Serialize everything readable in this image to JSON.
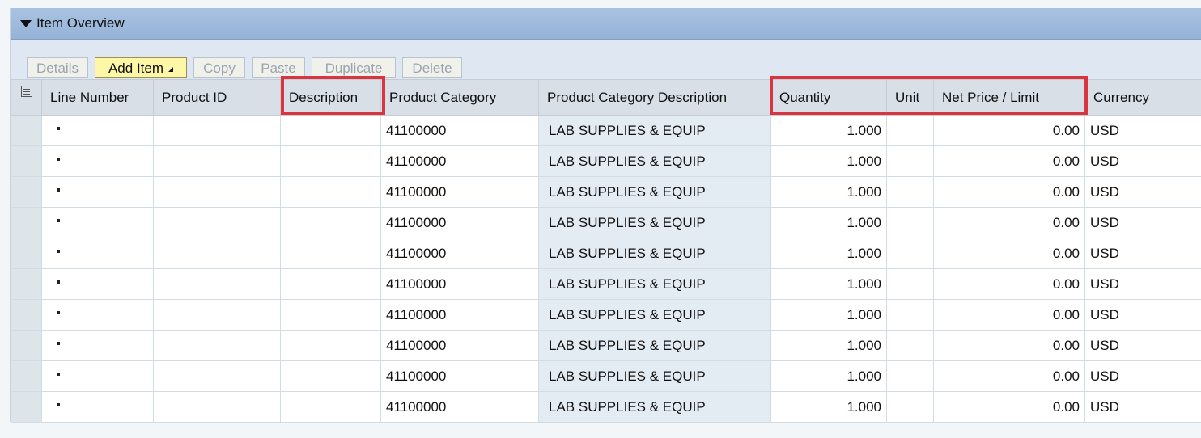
{
  "panel": {
    "title": "Item Overview"
  },
  "toolbar": {
    "details_label": "Details",
    "add_item_label": "Add Item",
    "copy_label": "Copy",
    "paste_label": "Paste",
    "duplicate_label": "Duplicate",
    "delete_label": "Delete"
  },
  "table": {
    "columns": {
      "line_number": "Line Number",
      "product_id": "Product ID",
      "description": "Description",
      "product_category": "Product Category",
      "product_category_description": "Product Category Description",
      "quantity": "Quantity",
      "unit": "Unit",
      "net_price": "Net Price / Limit",
      "currency": "Currency"
    },
    "rows": [
      {
        "product_category": "41100000",
        "product_category_description": "LAB SUPPLIES & EQUIP",
        "quantity": "1.000",
        "net_price": "0.00",
        "currency": "USD"
      },
      {
        "product_category": "41100000",
        "product_category_description": "LAB SUPPLIES & EQUIP",
        "quantity": "1.000",
        "net_price": "0.00",
        "currency": "USD"
      },
      {
        "product_category": "41100000",
        "product_category_description": "LAB SUPPLIES & EQUIP",
        "quantity": "1.000",
        "net_price": "0.00",
        "currency": "USD"
      },
      {
        "product_category": "41100000",
        "product_category_description": "LAB SUPPLIES & EQUIP",
        "quantity": "1.000",
        "net_price": "0.00",
        "currency": "USD"
      },
      {
        "product_category": "41100000",
        "product_category_description": "LAB SUPPLIES & EQUIP",
        "quantity": "1.000",
        "net_price": "0.00",
        "currency": "USD"
      },
      {
        "product_category": "41100000",
        "product_category_description": "LAB SUPPLIES & EQUIP",
        "quantity": "1.000",
        "net_price": "0.00",
        "currency": "USD"
      },
      {
        "product_category": "41100000",
        "product_category_description": "LAB SUPPLIES & EQUIP",
        "quantity": "1.000",
        "net_price": "0.00",
        "currency": "USD"
      },
      {
        "product_category": "41100000",
        "product_category_description": "LAB SUPPLIES & EQUIP",
        "quantity": "1.000",
        "net_price": "0.00",
        "currency": "USD"
      },
      {
        "product_category": "41100000",
        "product_category_description": "LAB SUPPLIES & EQUIP",
        "quantity": "1.000",
        "net_price": "0.00",
        "currency": "USD"
      },
      {
        "product_category": "41100000",
        "product_category_description": "LAB SUPPLIES & EQUIP",
        "quantity": "1.000",
        "net_price": "0.00",
        "currency": "USD"
      }
    ]
  },
  "colors": {
    "header_blue": "#a9c2e0",
    "highlight_red": "#d9343f",
    "active_button": "#fff7a8"
  }
}
